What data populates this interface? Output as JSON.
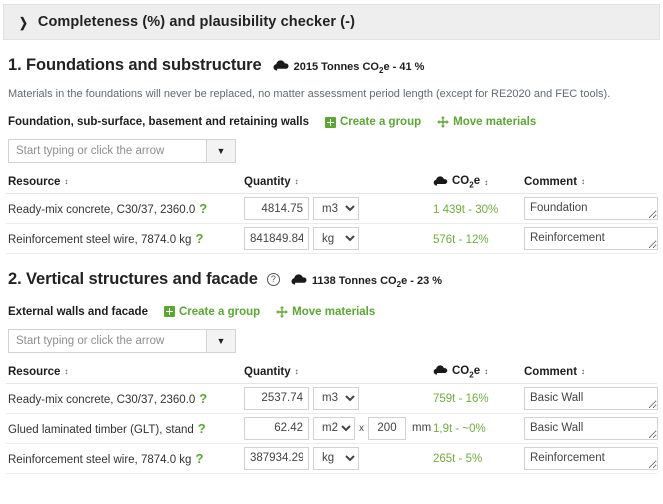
{
  "checker": {
    "title": "Completeness (%) and plausibility checker (-)",
    "chevron": "chevron-right-icon"
  },
  "table_headers": {
    "resource": "Resource",
    "quantity": "Quantity",
    "co2e": "CO",
    "co2e_sub": "2",
    "co2e_tail": "e",
    "comment": "Comment"
  },
  "combo_placeholder": "Start typing or click the arrow",
  "links": {
    "create_group": "Create a group",
    "move_materials": "Move materials"
  },
  "sections": [
    {
      "number": "1.",
      "title": "1. Foundations and substructure",
      "has_help": false,
      "summary_value": "2015 Tonnes CO",
      "summary_sub": "2",
      "summary_tail": "e - 41 %",
      "note": "Materials in the foundations will never be replaced, no matter assessment period length (except for RE2020 and FEC tools).",
      "group_name": "Foundation, sub-surface, basement and retaining walls",
      "rows": [
        {
          "resource": "Ready-mix concrete, C30/37, 2360.0",
          "quantity": "4814.75",
          "unit": "m3",
          "thickness": null,
          "thickness_unit": null,
          "co2e": "1 439t - 30%",
          "comment": "Foundation"
        },
        {
          "resource": "Reinforcement steel wire, 7874.0 kg",
          "quantity": "841849.84",
          "unit": "kg",
          "thickness": null,
          "thickness_unit": null,
          "co2e": "576t - 12%",
          "comment": "Reinforcement"
        }
      ]
    },
    {
      "number": "2.",
      "title": "2. Vertical structures and facade",
      "has_help": true,
      "summary_value": "1138 Tonnes CO",
      "summary_sub": "2",
      "summary_tail": "e - 23 %",
      "note": null,
      "group_name": "External walls and facade",
      "rows": [
        {
          "resource": "Ready-mix concrete, C30/37, 2360.0",
          "quantity": "2537.74",
          "unit": "m3",
          "thickness": null,
          "thickness_unit": null,
          "co2e": "759t - 16%",
          "comment": "Basic Wall"
        },
        {
          "resource": "Glued laminated timber (GLT), stand",
          "quantity": "62.42",
          "unit": "m2",
          "thickness": "200",
          "thickness_unit": "mm",
          "co2e": "1,9t - ~0%",
          "comment": "Basic Wall"
        },
        {
          "resource": "Reinforcement steel wire, 7874.0 kg",
          "quantity": "387934.29",
          "unit": "kg",
          "thickness": null,
          "thickness_unit": null,
          "co2e": "265t - 5%",
          "comment": "Reinforcement"
        }
      ]
    }
  ],
  "colors": {
    "green_link": "#5aa832",
    "green_value": "#6fae3d",
    "header_bar": "#eeeeee",
    "note_text": "#5f6b72"
  }
}
